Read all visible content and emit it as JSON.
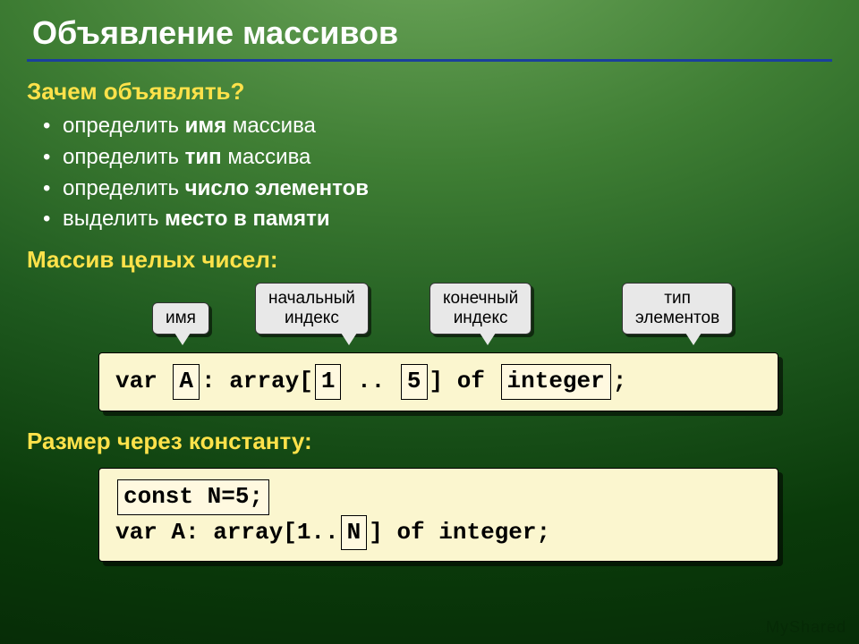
{
  "title": "Объявление массивов",
  "why": {
    "heading": "Зачем объявлять?",
    "items": [
      {
        "pre": "определить ",
        "bold": "имя",
        "post": " массива"
      },
      {
        "pre": "определить ",
        "bold": "тип",
        "post": " массива"
      },
      {
        "pre": "определить ",
        "bold": "число элементов",
        "post": ""
      },
      {
        "pre": "выделить ",
        "bold": "место в памяти",
        "post": ""
      }
    ]
  },
  "int_array_heading": "Массив целых чисел:",
  "callouts": {
    "name": "имя",
    "start": "начальный\nиндекс",
    "end": "конечный\nиндекс",
    "type": "тип\nэлементов"
  },
  "code1": {
    "p0": "var ",
    "hA": "A",
    "p1": ": array[",
    "h1": "1",
    "p2": " .. ",
    "h5": "5",
    "p3": "] of ",
    "hInt": "integer",
    "p4": ";"
  },
  "const_heading": "Размер через константу:",
  "code2": {
    "hConst": "const N=5;",
    "l2a": "var A: array[1..",
    "hN": "N",
    "l2b": "] of integer;"
  },
  "watermark": "MyShared"
}
